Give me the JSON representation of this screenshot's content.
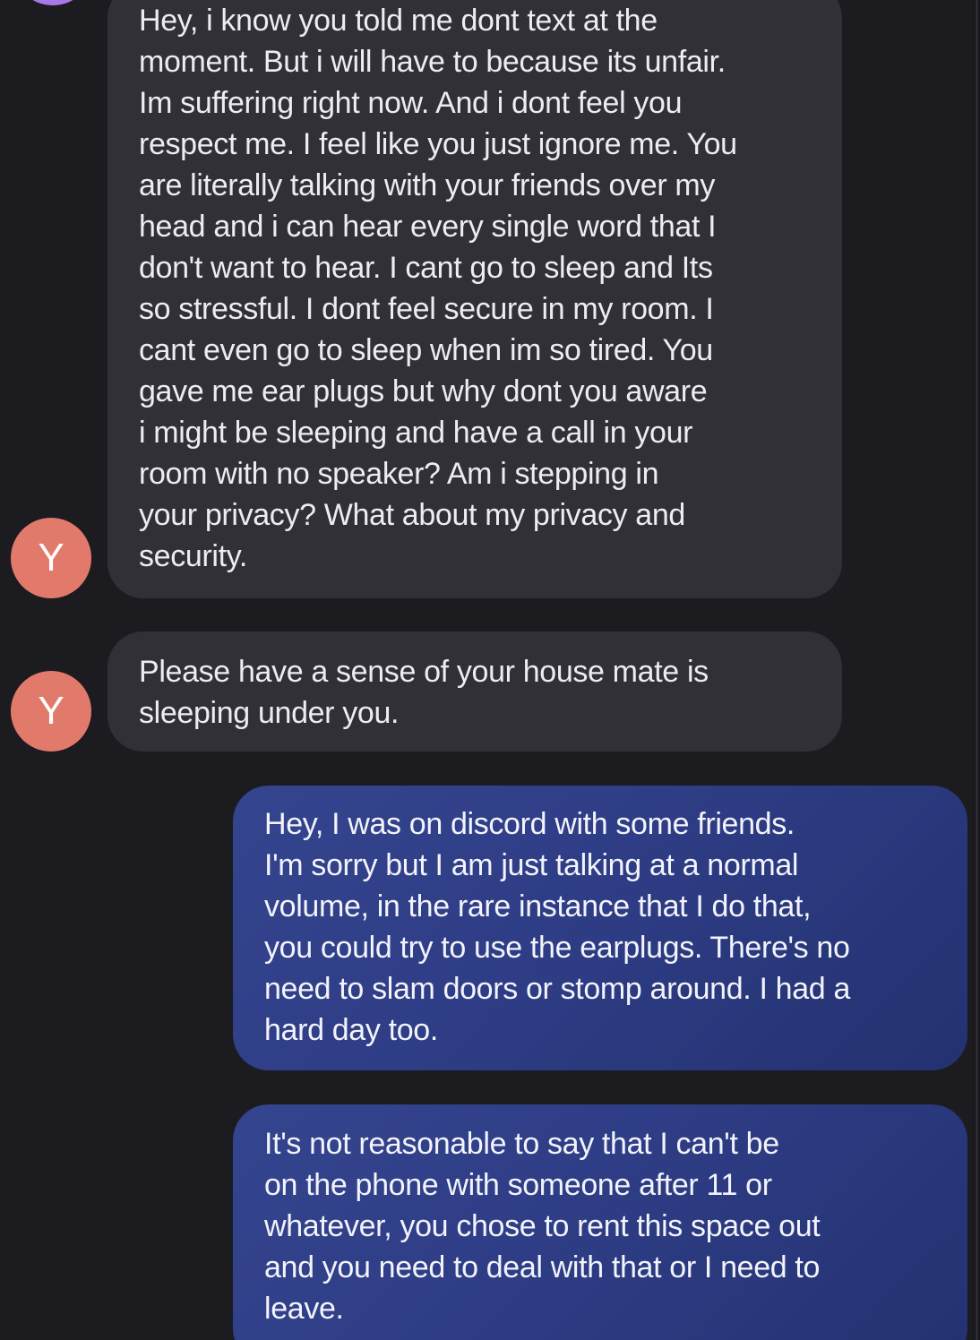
{
  "conversation": {
    "messages": [
      {
        "direction": "incoming",
        "avatar_letter": "",
        "text": "Hey, i know you told me dont text at the\nmoment. But i will have to because its unfair.\nIm suffering right now. And i dont feel you\nrespect me. I feel like you just ignore me. You\nare literally talking with your friends over my\nhead  and i can hear every single word that I\ndon't want to hear. I cant go to sleep and Its\nso stressful. I dont feel secure in my room. I\ncant even go to sleep when im so tired. You\ngave me ear plugs but why dont you aware\ni might be sleeping and have a call in your\nroom with no speaker? Am i stepping in\nyour privacy? What about my privacy and\nsecurity."
      },
      {
        "direction": "incoming",
        "avatar_letter": "Y",
        "text": "Please have a sense of your house mate is\nsleeping under you."
      },
      {
        "direction": "outgoing",
        "text": "Hey, I was on discord with some friends.\nI'm sorry but I am just talking at a normal\nvolume, in the rare instance that I do that,\nyou could try to use the earplugs. There's no\nneed to slam doors or stomp around. I had a\nhard day too."
      },
      {
        "direction": "outgoing",
        "text": "It's not reasonable to say that I can't be\non the phone with someone after 11 or\nwhatever, you chose to rent this space out\nand you need to deal with that or I need to\nleave."
      }
    ],
    "sender_avatar_letter": "Y"
  },
  "colors": {
    "background": "#1b1b20",
    "incoming_bubble": "#303036",
    "outgoing_bubble": "#2e3d85",
    "avatar": "#e27a6c",
    "top_avatar": "#a978e8",
    "text": "#ecedf2"
  }
}
